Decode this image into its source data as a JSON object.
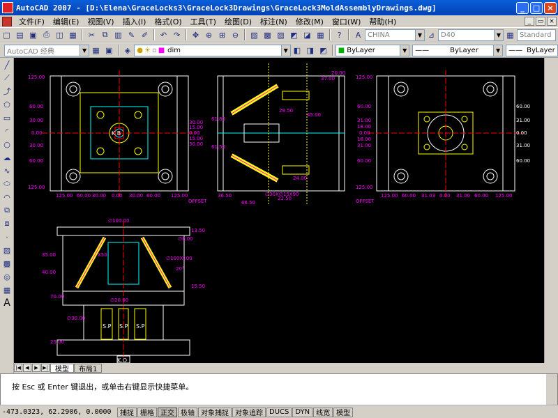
{
  "window": {
    "title": "AutoCAD 2007 - [D:\\Elena\\GraceLocks3\\GraceLock3Drawings\\GraceLock3MoldAssemblyDrawings.dwg]",
    "min_glyph": "_",
    "max_glyph": "□",
    "close_glyph": "×"
  },
  "menu": {
    "items": [
      "文件(F)",
      "编辑(E)",
      "视图(V)",
      "插入(I)",
      "格式(O)",
      "工具(T)",
      "绘图(D)",
      "标注(N)",
      "修改(M)",
      "窗口(W)",
      "帮助(H)"
    ]
  },
  "toolbar": {
    "text_style": "CHINA",
    "dim_style": "D40",
    "table_style": "Standard",
    "workspace": "AutoCAD 经典",
    "layer": "dim",
    "color": "ByLayer",
    "linetype": "ByLayer",
    "lineweight": "ByLayer"
  },
  "drawing": {
    "colors": {
      "dim": "#ff00ff",
      "geometry": "#ffffff",
      "parts": "#ffff00",
      "hidden": "#00ffff",
      "center": "#ff0000"
    },
    "top_left_dims": [
      "125.00",
      "60.00",
      "30.00",
      "0.00",
      "30.00",
      "60.00",
      "125.00"
    ],
    "top_left_bottom_dims": [
      "125.00",
      "60.00",
      "30.00",
      "0.00",
      "30.00",
      "60.00",
      "125.00"
    ],
    "top_left_right_dims": [
      "30.00",
      "15.00",
      "0.00",
      "15.00",
      "30.00"
    ],
    "kb_label": "K B",
    "offset_label": "OFFSET",
    "middle_dims": [
      "20.00",
      "29.50",
      "45.00",
      "36.50",
      "66.50",
      "22.50",
      "61.50",
      "61.80",
      "37.00",
      "24.00"
    ],
    "middle_callout": "∅30X∅15X90",
    "right_dims": [
      "125.00",
      "60.00",
      "31.00",
      "18.00",
      "0.00",
      "18.00",
      "31.00",
      "60.00",
      "125.00"
    ],
    "right_bottom_dims": [
      "125.00",
      "60.00",
      "31.03",
      "0.00",
      "31.00",
      "60.00",
      "125.00"
    ],
    "section_top_dim": "∅100.00",
    "section_dims": [
      "35.00",
      "40.00",
      "70.00",
      "25.00",
      "13.50",
      "15.50",
      "∅6.00",
      "∅30.00",
      "20°",
      "X50",
      "∅20.00"
    ],
    "section_callout": "∅100X100",
    "sp_labels": [
      "S.P",
      "S.P",
      "S.P"
    ],
    "ko_label": "K.O"
  },
  "tabs": {
    "model": "模型",
    "layout": "布局1"
  },
  "command": {
    "prompt": "按 Esc 或 Enter 键退出，或单击右键显示快捷菜单。"
  },
  "status": {
    "coords": "-473.0323, 62.2906, 0.0000",
    "buttons": [
      "捕捉",
      "栅格",
      "正交",
      "极轴",
      "对象捕捉",
      "对象追踪",
      "DUCS",
      "DYN",
      "线宽",
      "模型"
    ]
  }
}
